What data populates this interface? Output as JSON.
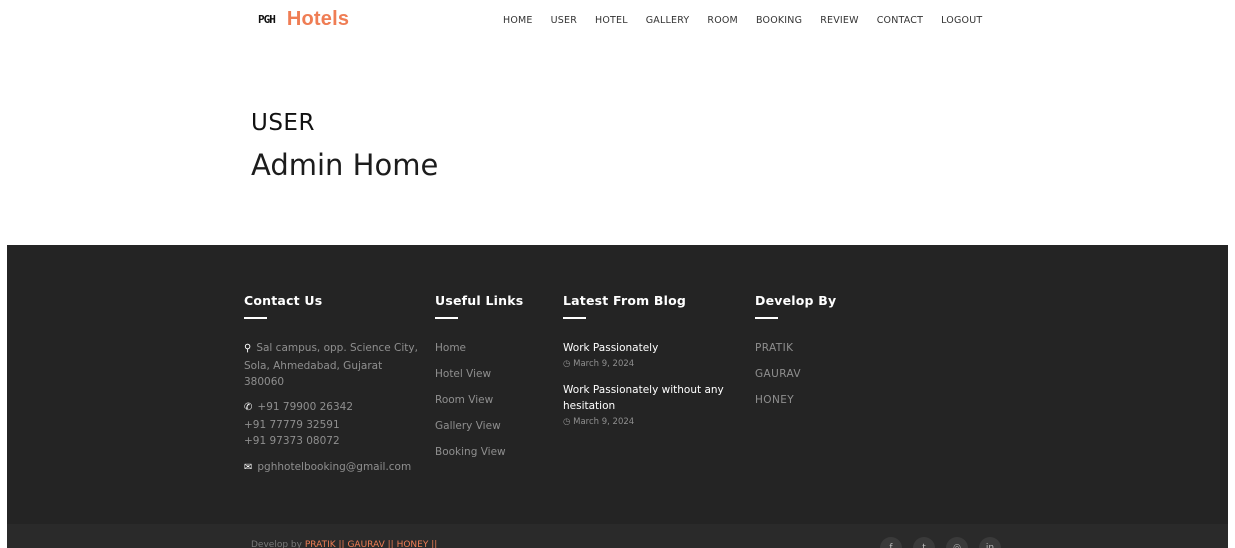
{
  "header": {
    "logo_mark": "PGH",
    "brand": "Hotels",
    "nav": [
      "HOME",
      "USER",
      "HOTEL",
      "GALLERY",
      "ROOM",
      "BOOKING",
      "REVIEW",
      "CONTACT",
      "LOGOUT"
    ]
  },
  "main": {
    "section_label": "USER",
    "title": "Admin Home"
  },
  "footer": {
    "contact": {
      "heading": "Contact Us",
      "address": "Sal campus, opp. Science City, Sola, Ahmedabad, Gujarat 380060",
      "phones": [
        "+91 79900 26342",
        "+91 77779 32591",
        "+91 97373 08072"
      ],
      "email": "pghhotelbooking@gmail.com"
    },
    "useful_links": {
      "heading": "Useful Links",
      "items": [
        "Home",
        "Hotel View",
        "Room View",
        "Gallery View",
        "Booking View"
      ]
    },
    "blog": {
      "heading": "Latest From Blog",
      "posts": [
        {
          "title": "Work Passionately",
          "date": "March 9, 2024"
        },
        {
          "title": "Work Passionately without any hesitation",
          "date": "March 9, 2024"
        }
      ]
    },
    "develop_by": {
      "heading": "Develop By",
      "items": [
        "PRATIK",
        "GAURAV",
        "HONEY"
      ]
    },
    "credits": {
      "prefix": "Develop by",
      "names": "PRATIK || GAURAV || HONEY ||"
    },
    "social": [
      "f",
      "t",
      "◎",
      "in"
    ]
  },
  "colors": {
    "accent": "#ef7d54",
    "footer_bg": "#242424"
  }
}
